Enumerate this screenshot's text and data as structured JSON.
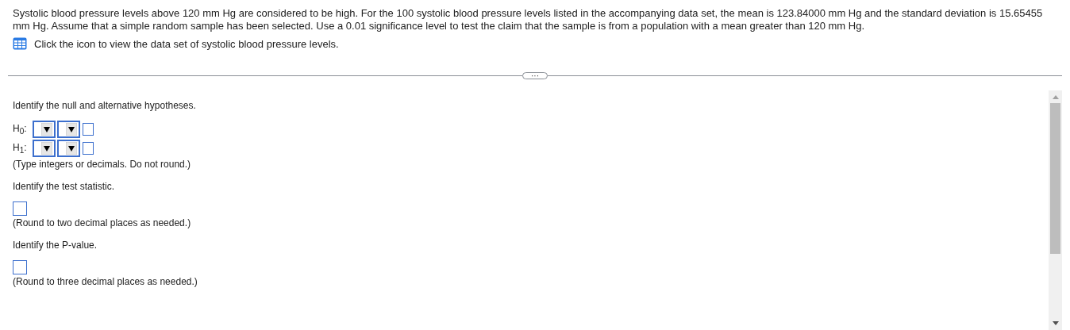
{
  "question": {
    "text": "Systolic blood pressure levels above 120 mm Hg are considered to be high. For the 100 systolic blood pressure levels listed in the accompanying data set, the mean is 123.84000 mm Hg and the standard deviation is 15.65455 mm Hg. Assume that a simple random sample has been selected. Use a 0.01 significance level to test the claim that the sample is from a population with a mean greater than 120 mm Hg.",
    "data_link": "Click the icon to view the data set of systolic blood pressure levels."
  },
  "expand_button": "···",
  "parts": [
    {
      "kind": "hypotheses",
      "prompt": "Identify the null and alternative hypotheses.",
      "rows": [
        {
          "label": "H$_{0}$:"
        },
        {
          "label": "H$_{1}$:"
        }
      ],
      "note": "(Type integers or decimals. Do not round.)"
    },
    {
      "kind": "answer",
      "prompt": "Identify the test statistic.",
      "note": "(Round to two decimal places as needed.)"
    },
    {
      "kind": "answer",
      "prompt": "Identify the P-value.",
      "note": "(Round to three decimal places as needed.)"
    }
  ]
}
